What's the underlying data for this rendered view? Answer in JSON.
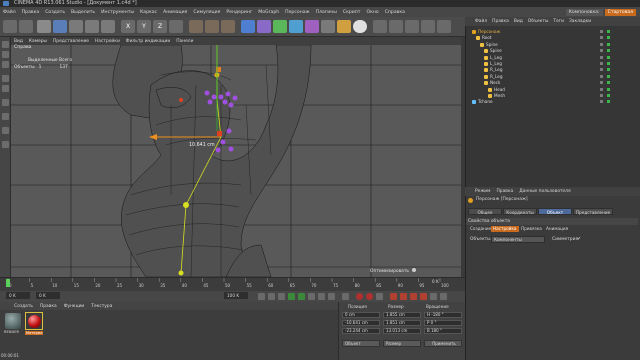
{
  "window": {
    "title": "CINEMA 4D R13.061 Studio - [Документ 1.c4d *]"
  },
  "menubar": [
    "Файл",
    "Правка",
    "Создать",
    "Выделить",
    "Инструменты",
    "Каркас",
    "Анимация",
    "Симуляция",
    "Рендеринг",
    "MoGraph",
    "Персонаж",
    "Плагины",
    "Скрипт",
    "Окно",
    "Справка"
  ],
  "layout": {
    "label": "Компоновка:",
    "value": "Стартовая"
  },
  "viewport": {
    "menu": [
      "Вид",
      "Камеры",
      "Представление",
      "Настройки",
      "Фильтр индикации",
      "Панели"
    ],
    "name": "Справа",
    "hud_header": "Выделенные  Всего",
    "hud_label": "Объекты",
    "hud_selected": "1",
    "hud_total": "137",
    "measure": "10.641 cm",
    "optimize_btn": "Оптимизировать"
  },
  "timeline": {
    "ticks": [
      "0",
      "5",
      "10",
      "15",
      "20",
      "25",
      "30",
      "35",
      "40",
      "45",
      "50",
      "55",
      "60",
      "65",
      "70",
      "75",
      "80",
      "85",
      "90",
      "95",
      "100"
    ],
    "end_label": "0 K",
    "current": "0 K",
    "start": "0 K",
    "end": "100 K",
    "right_readout": "100 K"
  },
  "materials": {
    "menu": [
      "Создать",
      "Правка",
      "Функции",
      "Текстура"
    ],
    "items": [
      {
        "name": "RENDER"
      },
      {
        "name": "Материа"
      }
    ]
  },
  "coords": {
    "headers": [
      "Позиция",
      "Размер",
      "Вращение"
    ],
    "rows": [
      {
        "pos": "0 cm",
        "size": "1.855 cm",
        "rot": "H  -180 °"
      },
      {
        "pos": "-10.641 cm",
        "size": "1.851 cm",
        "rot": "P  0 °"
      },
      {
        "pos": "-23.244 cm",
        "size": "13.013 cm",
        "rot": "B  180 °"
      }
    ],
    "mode1": "Объект",
    "mode2": "Размер",
    "apply": "Применить"
  },
  "objmgr": {
    "menu": [
      "Файл",
      "Правка",
      "Вид",
      "Объекты",
      "Теги",
      "Закладки"
    ],
    "rows": [
      {
        "name": "Персонаж",
        "color": "#e0a020",
        "indent": 0,
        "sel": true
      },
      {
        "name": "Root",
        "color": "#f0c040",
        "indent": 1
      },
      {
        "name": "Spine",
        "color": "#f0c040",
        "indent": 2
      },
      {
        "name": "Spine",
        "color": "#f0c040",
        "indent": 3
      },
      {
        "name": "L_Leg",
        "color": "#f0c040",
        "indent": 3
      },
      {
        "name": "L_Leg",
        "color": "#f0c040",
        "indent": 3
      },
      {
        "name": "R_Leg",
        "color": "#f0c040",
        "indent": 3
      },
      {
        "name": "R_Leg",
        "color": "#f0c040",
        "indent": 3
      },
      {
        "name": "Neck",
        "color": "#f0c040",
        "indent": 3
      },
      {
        "name": "Head",
        "color": "#f0c040",
        "indent": 4
      },
      {
        "name": "Mesh",
        "color": "#f0c040",
        "indent": 4
      },
      {
        "name": "Tchane",
        "color": "#60c0ff",
        "indent": 0
      }
    ]
  },
  "attr": {
    "menu": [
      "Режим",
      "Правка",
      "Данные пользователя"
    ],
    "object_title": "Персонаж [Персонаж]",
    "tabs": [
      "Общее",
      "Координаты",
      "Объект",
      "Представление"
    ],
    "section": "Свойства объекта",
    "subtabs": [
      "Создание",
      "Настройка",
      "Привязка",
      "Анимация"
    ],
    "objects_label": "Объекты",
    "objects_value": "Компоненты",
    "symmetry_label": "Симметрия",
    "symmetry_check": "✓"
  },
  "status": "00:00:01",
  "colors": {
    "accent": "#c86a1e",
    "joint": "#a050e0",
    "jointTop": "#e04020",
    "bone": "#d8e020",
    "wire": "#1e1e1e"
  }
}
